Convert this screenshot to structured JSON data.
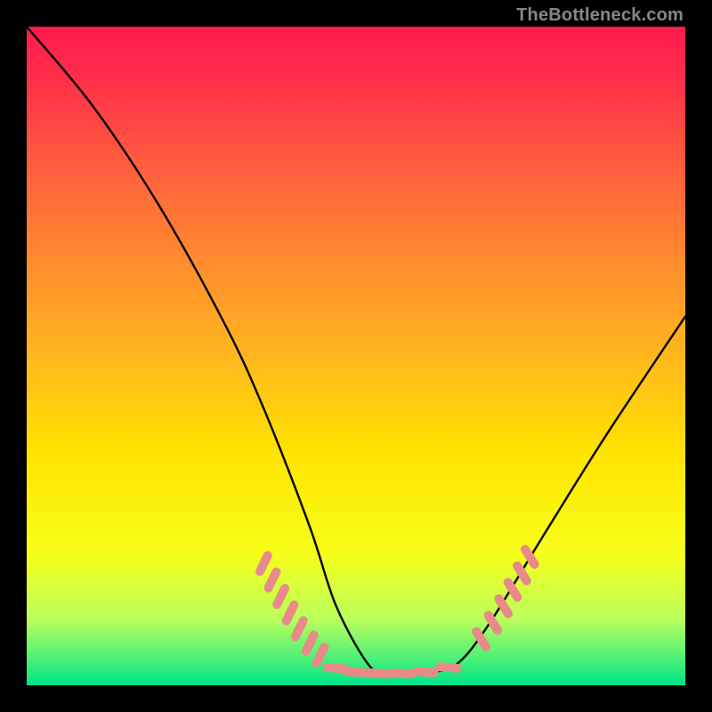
{
  "watermark": {
    "text": "TheBottleneck.com"
  },
  "chart_data": {
    "type": "line",
    "title": "",
    "xlabel": "",
    "ylabel": "",
    "xlim": [
      0,
      100
    ],
    "ylim": [
      0,
      100
    ],
    "grid": false,
    "series": [
      {
        "name": "curve",
        "x": [
          0,
          10,
          20,
          30,
          36,
          43,
          47,
          52,
          55,
          60,
          65,
          70,
          78,
          88,
          100
        ],
        "values": [
          100,
          88,
          73,
          55,
          42,
          24,
          12,
          3,
          2,
          2,
          3,
          9,
          22,
          38,
          56
        ]
      }
    ],
    "annotations": {
      "marker_color": "#e88a8a",
      "markers": [
        {
          "group": "left",
          "x": 36.0,
          "y": 18.5
        },
        {
          "group": "left",
          "x": 37.3,
          "y": 16.0
        },
        {
          "group": "left",
          "x": 38.6,
          "y": 13.5
        },
        {
          "group": "left",
          "x": 40.0,
          "y": 11.0
        },
        {
          "group": "left",
          "x": 41.4,
          "y": 8.6
        },
        {
          "group": "left",
          "x": 43.0,
          "y": 6.4
        },
        {
          "group": "left",
          "x": 44.6,
          "y": 4.6
        },
        {
          "group": "bottom",
          "x": 47.0,
          "y": 2.6
        },
        {
          "group": "bottom",
          "x": 50.0,
          "y": 2.0
        },
        {
          "group": "bottom",
          "x": 53.5,
          "y": 1.8
        },
        {
          "group": "bottom",
          "x": 57.0,
          "y": 1.8
        },
        {
          "group": "bottom",
          "x": 60.5,
          "y": 2.0
        },
        {
          "group": "bottom",
          "x": 64.0,
          "y": 2.7
        },
        {
          "group": "right",
          "x": 69.0,
          "y": 7.0
        },
        {
          "group": "right",
          "x": 70.8,
          "y": 9.5
        },
        {
          "group": "right",
          "x": 72.4,
          "y": 12.0
        },
        {
          "group": "right",
          "x": 73.8,
          "y": 14.5
        },
        {
          "group": "right",
          "x": 75.2,
          "y": 17.0
        },
        {
          "group": "right",
          "x": 76.4,
          "y": 19.5
        }
      ]
    }
  }
}
